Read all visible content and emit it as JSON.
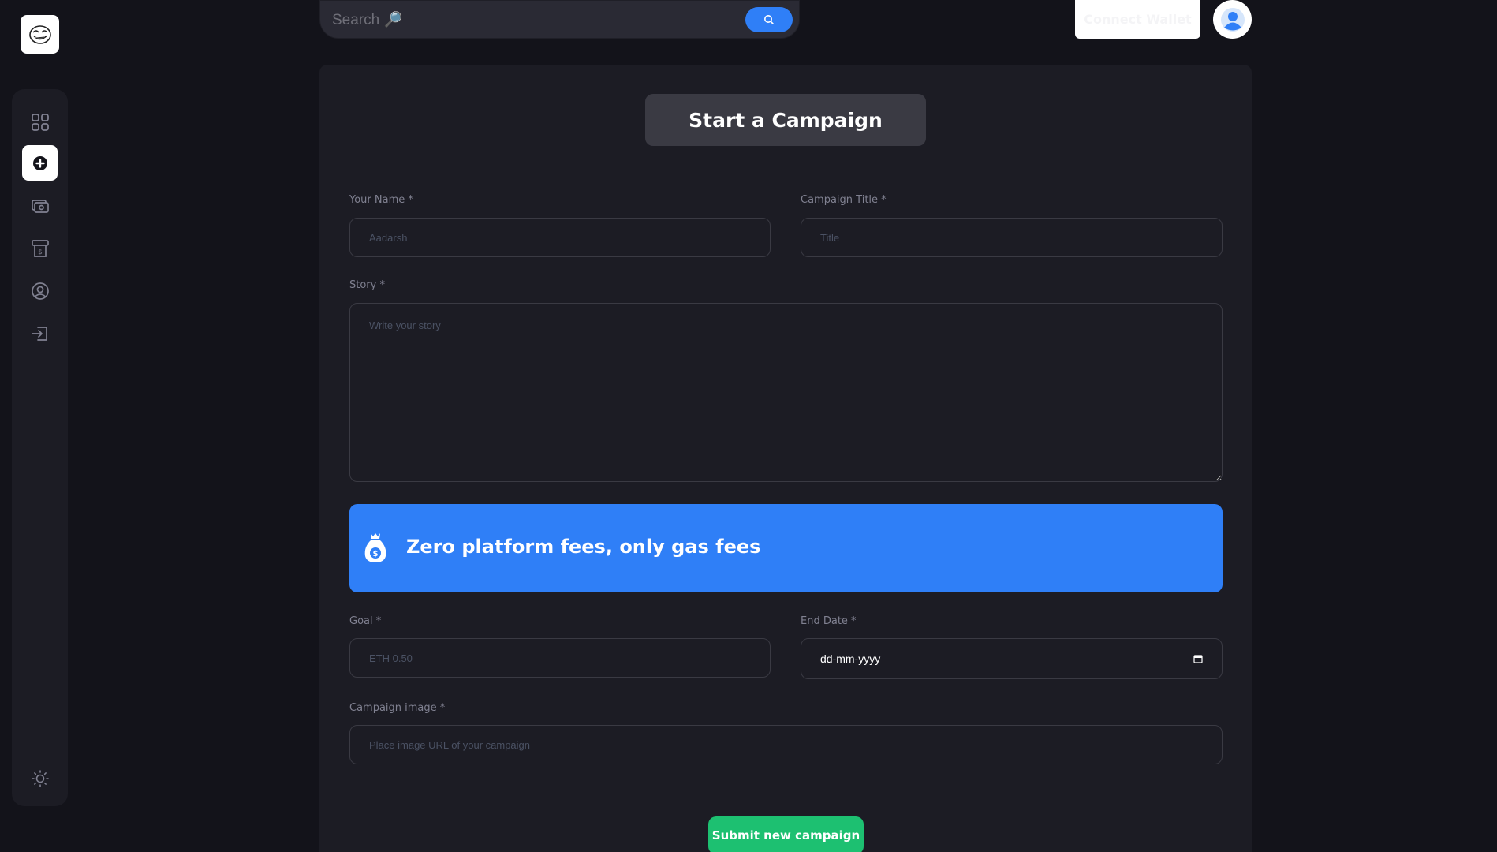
{
  "header": {
    "search_placeholder": "Search 🔎",
    "connect_label": "Connect Wallet"
  },
  "sidebar": {
    "items": [
      {
        "icon": "dashboard-icon",
        "active": false
      },
      {
        "icon": "create-campaign-icon",
        "active": true
      },
      {
        "icon": "payment-icon",
        "active": false
      },
      {
        "icon": "withdraw-icon",
        "active": false
      },
      {
        "icon": "profile-icon",
        "active": false
      },
      {
        "icon": "logout-icon",
        "active": false
      }
    ],
    "theme_icon": "sun-icon"
  },
  "form": {
    "title": "Start a Campaign",
    "name_label": "Your Name *",
    "name_placeholder": "Aadarsh",
    "campaign_title_label": "Campaign Title *",
    "campaign_title_placeholder": "Title",
    "story_label": "Story *",
    "story_placeholder": "Write your story",
    "banner_text": "Zero platform fees, only gas fees",
    "goal_label": "Goal *",
    "goal_placeholder": "ETH 0.50",
    "end_date_label": "End Date *",
    "end_date_value": "dd-mm-yyyy",
    "image_label": "Campaign image *",
    "image_placeholder": "Place image URL of your campaign",
    "submit_label": "Submit new campaign"
  },
  "colors": {
    "background": "#13131a",
    "card": "#1c1c24",
    "accent_blue": "#2f7ff7",
    "accent_green": "#1dc071"
  }
}
